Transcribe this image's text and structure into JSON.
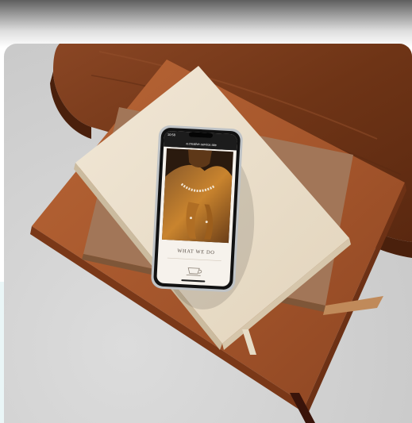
{
  "phone": {
    "status_time": "10:58",
    "url": "a.creative.service.site",
    "section_heading": "WHAT WE DO"
  },
  "colors": {
    "table_wood": "#7a3c1e",
    "leather_book": "#a9592e",
    "cream_book": "#ece0cc",
    "tan_book": "#a27658"
  }
}
